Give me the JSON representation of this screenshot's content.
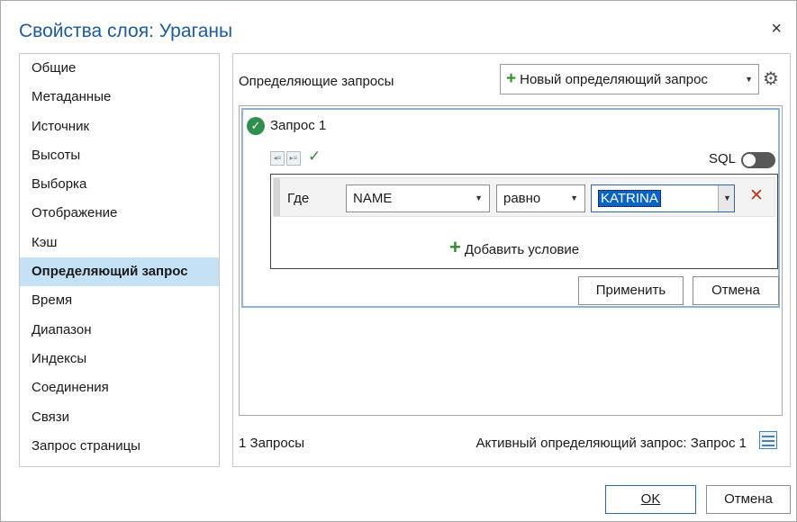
{
  "dialog": {
    "title": "Свойства слоя: Ураганы",
    "close_glyph": "×"
  },
  "sidebar": {
    "items": [
      {
        "label": "Общие"
      },
      {
        "label": "Метаданные"
      },
      {
        "label": "Источник"
      },
      {
        "label": "Высоты"
      },
      {
        "label": "Выборка"
      },
      {
        "label": "Отображение"
      },
      {
        "label": "Кэш"
      },
      {
        "label": "Определяющий запрос",
        "active": true
      },
      {
        "label": "Время"
      },
      {
        "label": "Диапазон"
      },
      {
        "label": "Индексы"
      },
      {
        "label": "Соединения"
      },
      {
        "label": "Связи"
      },
      {
        "label": "Запрос страницы"
      }
    ]
  },
  "main": {
    "section_title": "Определяющие запросы",
    "new_query_label": "Новый определяющий запрос",
    "query": {
      "name": "Запрос 1",
      "sql_label": "SQL",
      "sql_enabled": false,
      "clause": {
        "where_label": "Где",
        "field": "NAME",
        "operator": "равно",
        "value": "KATRINA"
      },
      "add_condition_label": "Добавить условие",
      "apply_label": "Применить",
      "cancel_label": "Отмена"
    },
    "count_label": "1 Запросы",
    "active_query_label": "Активный определяющий запрос: Запрос 1"
  },
  "footer": {
    "ok_label": "OK",
    "cancel_label": "Отмена"
  },
  "icons": {
    "plus": "plus-icon",
    "gear": "gear-icon",
    "check": "check-circle-icon",
    "delete": "delete-x-icon",
    "table": "table-icon"
  },
  "colors": {
    "accent": "#1a5aa6",
    "selection": "#c5e1f5",
    "success": "#2f8f2f",
    "danger": "#c0391f"
  }
}
